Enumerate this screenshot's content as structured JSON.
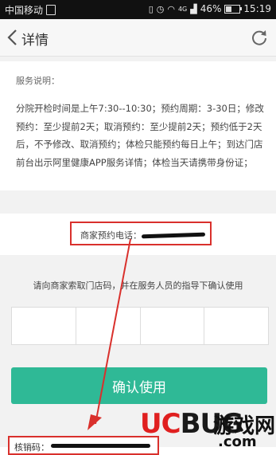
{
  "status_bar": {
    "carrier": "中国移动",
    "network": "4G",
    "battery": "46%",
    "time": "15:19"
  },
  "nav": {
    "title": "详情"
  },
  "service": {
    "label": "服务说明：",
    "text": "分院开检时间是上午7:30--10:30；预约周期：3-30日；修改预约：至少提前2天；取消预约：至少提前2天；预约低于2天后，不予修改、取消预约；体检只能预约每日上午；到达门店前台出示阿里健康APP服务详情；体检当天请携带身份证；"
  },
  "merchant_phone": {
    "label": "商家预约电话："
  },
  "instruction": "请向商家索取门店码，并在服务人员的指导下确认使用",
  "confirm_button": "确认使用",
  "verification": {
    "label": "核销码："
  },
  "watermark": {
    "brand_red": "UC",
    "brand_black": "BUG",
    "cn": "游戏网",
    "domain": ".com"
  },
  "colors": {
    "accent": "#2fb996",
    "highlight": "#d9302c"
  }
}
